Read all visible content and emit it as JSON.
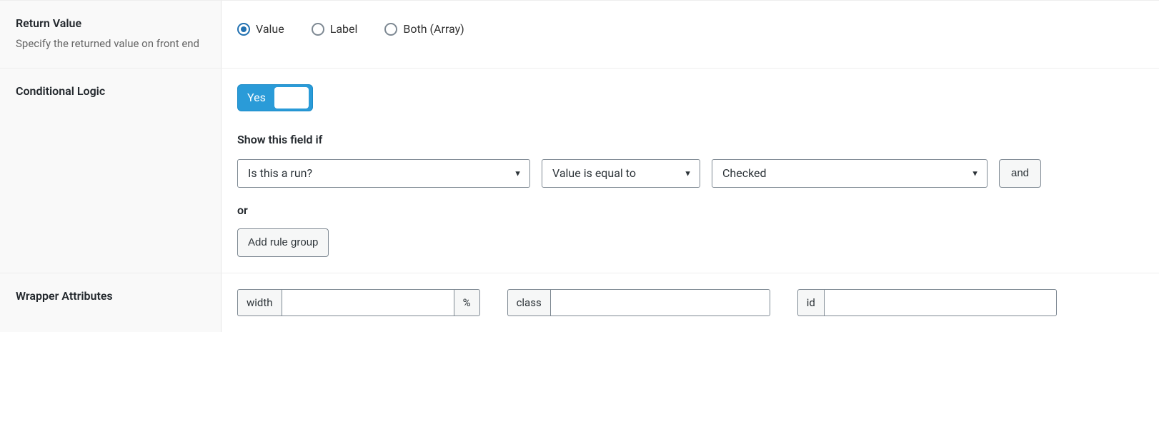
{
  "returnValue": {
    "title": "Return Value",
    "desc": "Specify the returned value on front end",
    "options": {
      "value": "Value",
      "label": "Label",
      "both": "Both (Array)"
    }
  },
  "conditionalLogic": {
    "title": "Conditional Logic",
    "toggle": "Yes",
    "showIf": "Show this field if",
    "rule": {
      "field": "Is this a run?",
      "operator": "Value is equal to",
      "value": "Checked"
    },
    "andBtn": "and",
    "orText": "or",
    "addRuleBtn": "Add rule group"
  },
  "wrapper": {
    "title": "Wrapper Attributes",
    "widthLabel": "width",
    "widthUnit": "%",
    "classLabel": "class",
    "idLabel": "id",
    "widthValue": "",
    "classValue": "",
    "idValue": ""
  }
}
